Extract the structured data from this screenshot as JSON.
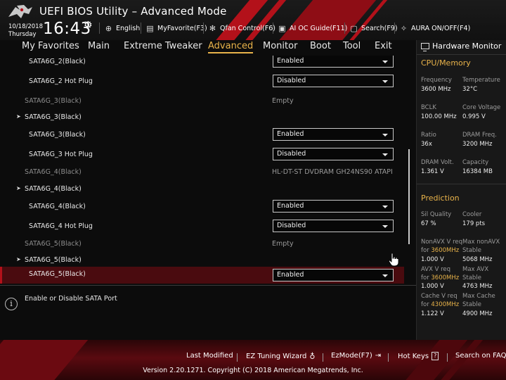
{
  "header": {
    "title": "UEFI BIOS Utility – Advanced Mode",
    "date": "10/18/2018",
    "weekday": "Thursday",
    "time": "16:43",
    "items": [
      {
        "icon": "globe-icon",
        "label": "English"
      },
      {
        "icon": "myfavorite-icon",
        "label": "MyFavorite(F3)"
      },
      {
        "icon": "fan-icon",
        "label": "Qfan Control(F6)"
      },
      {
        "icon": "ai-oc-icon",
        "label": "AI OC Guide(F11)"
      },
      {
        "icon": "search-icon",
        "label": "Search(F9)"
      },
      {
        "icon": "aura-icon",
        "label": "AURA ON/OFF(F4)"
      }
    ]
  },
  "menu": {
    "tabs": [
      "My Favorites",
      "Main",
      "Extreme Tweaker",
      "Advanced",
      "Monitor",
      "Boot",
      "Tool",
      "Exit"
    ],
    "active": "Advanced"
  },
  "settings": [
    {
      "label": "SATA6G_2(Black)",
      "type": "dropdown",
      "value": "Enabled"
    },
    {
      "label": "SATA6G_2 Hot Plug",
      "type": "dropdown",
      "value": "Disabled"
    },
    {
      "label": "SATA6G_3(Black)",
      "type": "info",
      "value": "Empty"
    },
    {
      "label": "SATA6G_3(Black)",
      "type": "submenu"
    },
    {
      "label": "SATA6G_3(Black)",
      "type": "dropdown",
      "value": "Enabled"
    },
    {
      "label": "SATA6G_3 Hot Plug",
      "type": "dropdown",
      "value": "Disabled"
    },
    {
      "label": "SATA6G_4(Black)",
      "type": "info",
      "value": "HL-DT-ST DVDRAM GH24NS90 ATAPI"
    },
    {
      "label": "SATA6G_4(Black)",
      "type": "submenu"
    },
    {
      "label": "SATA6G_4(Black)",
      "type": "dropdown",
      "value": "Enabled"
    },
    {
      "label": "SATA6G_4 Hot Plug",
      "type": "dropdown",
      "value": "Disabled"
    },
    {
      "label": "SATA6G_5(Black)",
      "type": "info",
      "value": "Empty"
    },
    {
      "label": "SATA6G_5(Black)",
      "type": "submenu"
    },
    {
      "label": "SATA6G_5(Black)",
      "type": "dropdown",
      "value": "Enabled",
      "selected": true
    }
  ],
  "help": {
    "text": "Enable or Disable SATA Port"
  },
  "hardware_monitor": {
    "title": "Hardware Monitor",
    "cpu_memory": {
      "section": "CPU/Memory",
      "frequency_label": "Frequency",
      "frequency": "3600 MHz",
      "temperature_label": "Temperature",
      "temperature": "32°C",
      "bclk_label": "BCLK",
      "bclk": "100.00 MHz",
      "core_voltage_label": "Core Voltage",
      "core_voltage": "0.995 V",
      "ratio_label": "Ratio",
      "ratio": "36x",
      "dram_freq_label": "DRAM Freq.",
      "dram_freq": "3200 MHz",
      "dram_volt_label": "DRAM Volt.",
      "dram_volt": "1.361 V",
      "capacity_label": "Capacity",
      "capacity": "16384 MB"
    },
    "prediction": {
      "section": "Prediction",
      "sil_quality_label": "Sil Quality",
      "sil_quality": "67 %",
      "cooler_label": "Cooler",
      "cooler": "179 pts",
      "nonavx_req_label": "NonAVX V req",
      "nonavx_for": "for",
      "nonavx_freq": "3600MHz",
      "nonavx_v": "1.000 V",
      "max_nonavx_label": "Max nonAVX",
      "max_nonavx_stable": "Stable",
      "max_nonavx": "5068 MHz",
      "avx_req_label": "AVX V req",
      "avx_for": "for",
      "avx_freq": "3600MHz",
      "avx_v": "1.000 V",
      "max_avx_label": "Max AVX",
      "max_avx_stable": "Stable",
      "max_avx": "4763 MHz",
      "cache_req_label": "Cache V req",
      "cache_for": "for",
      "cache_freq": "4300MHz",
      "cache_v": "1.122 V",
      "max_cache_label": "Max Cache",
      "max_cache_stable": "Stable",
      "max_cache": "4900 MHz"
    }
  },
  "footer": {
    "last_modified": "Last Modified",
    "ez_tuning": "EZ Tuning Wizard",
    "ezmode": "EzMode(F7)",
    "hotkeys": "Hot Keys",
    "hotkeys_key": "?",
    "search_faq": "Search on FAQ",
    "copyright": "Version 2.20.1271. Copyright (C) 2018 American Megatrends, Inc."
  },
  "colors": {
    "accent": "#e9b34a",
    "brand_red": "#b3111a",
    "selected_row": "#4a0b0f"
  }
}
